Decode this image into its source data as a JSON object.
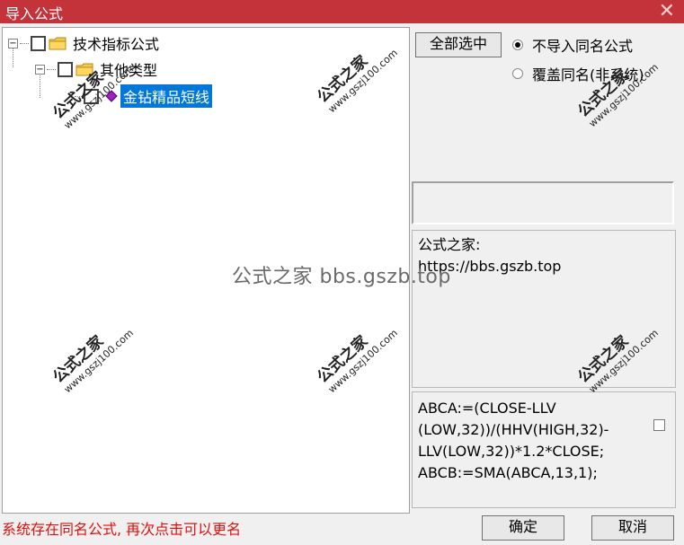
{
  "window": {
    "title": "导入公式",
    "close_glyph": "✕"
  },
  "tree": {
    "root": {
      "label": "技术指标公式",
      "expander": "⊟"
    },
    "child": {
      "label": "其他类型",
      "expander": "⊟"
    },
    "leaf": {
      "label": "金钻精品短线"
    }
  },
  "actions": {
    "select_all": "全部选中",
    "ok": "确定",
    "cancel": "取消"
  },
  "options": {
    "no_import_same": "不导入同名公式",
    "overwrite_same": "覆盖同名(非系统)",
    "selected": "no_import_same"
  },
  "info": {
    "line1": "公式之家:",
    "line2": "https://bbs.gszb.top"
  },
  "code": {
    "text": "ABCA:=(CLOSE-LLV\n(LOW,32))/(HHV(HIGH,32)-\nLLV(LOW,32))*1.2*CLOSE;\nABCB:=SMA(ABCA,13,1);"
  },
  "status": {
    "message": "系统存在同名公式, 再次点击可以更名"
  },
  "watermarks": {
    "center": "公式之家 bbs.gszb.top",
    "tile_big": "公式之家",
    "tile_small": "www.gszj100.com"
  }
}
